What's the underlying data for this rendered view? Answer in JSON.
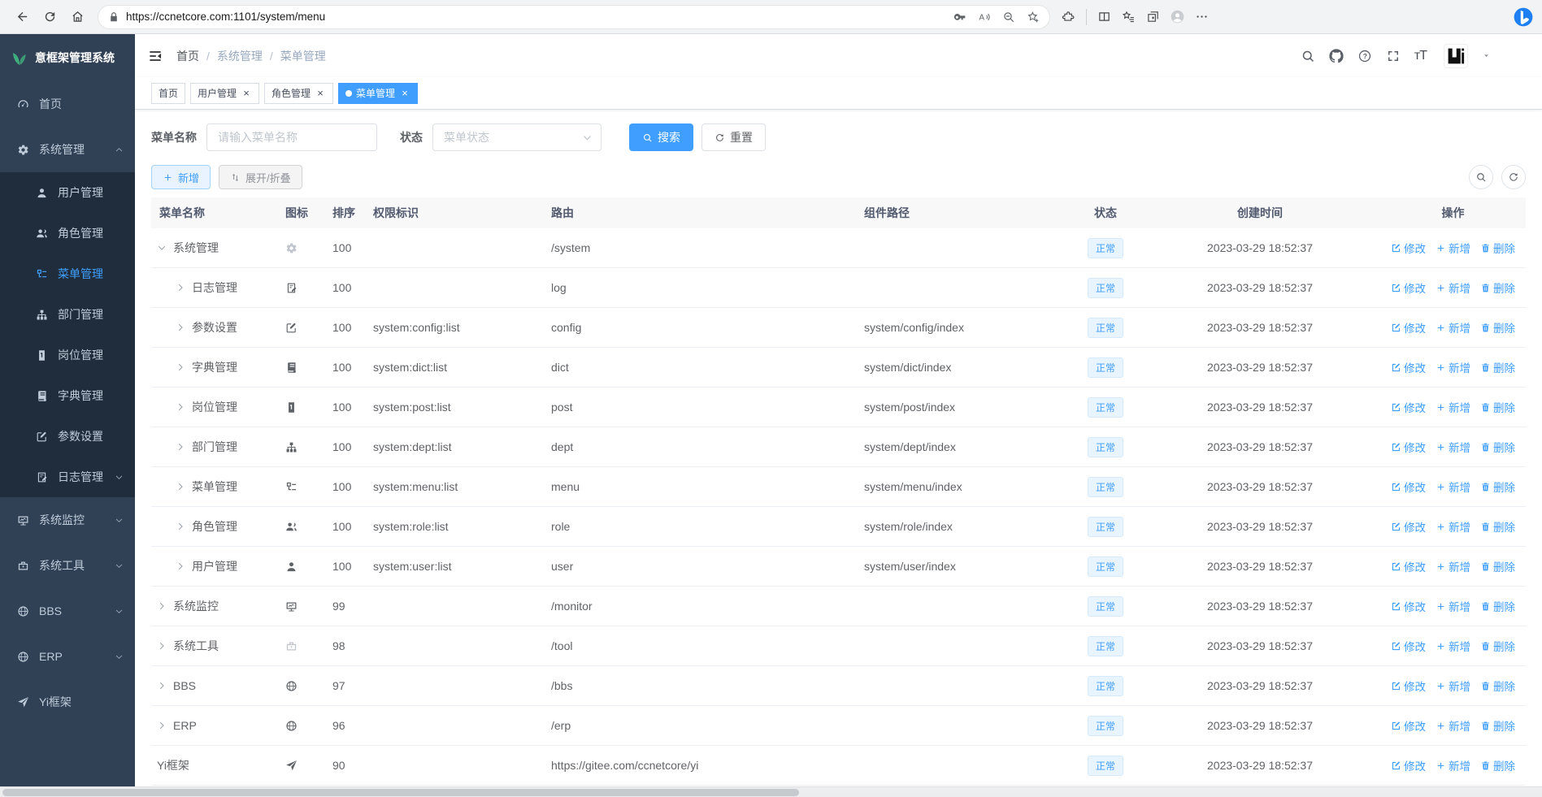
{
  "browser": {
    "url": "https://ccnetcore.com:1101/system/menu"
  },
  "app": {
    "logo_title": "意框架管理系统",
    "breadcrumb": [
      "首页",
      "系统管理",
      "菜单管理"
    ]
  },
  "sidebar": [
    {
      "label": "首页",
      "icon": "dashboard",
      "type": "top"
    },
    {
      "label": "系统管理",
      "icon": "gear",
      "type": "top",
      "caret": "up"
    },
    {
      "label": "用户管理",
      "icon": "user",
      "type": "sub"
    },
    {
      "label": "角色管理",
      "icon": "peoples",
      "type": "sub"
    },
    {
      "label": "菜单管理",
      "icon": "tree-table",
      "type": "sub",
      "active": true
    },
    {
      "label": "部门管理",
      "icon": "tree",
      "type": "sub"
    },
    {
      "label": "岗位管理",
      "icon": "post",
      "type": "sub"
    },
    {
      "label": "字典管理",
      "icon": "dict",
      "type": "sub"
    },
    {
      "label": "参数设置",
      "icon": "edit",
      "type": "sub"
    },
    {
      "label": "日志管理",
      "icon": "log",
      "type": "sub",
      "caret": "down"
    },
    {
      "label": "系统监控",
      "icon": "monitor",
      "type": "top",
      "caret": "down"
    },
    {
      "label": "系统工具",
      "icon": "tool",
      "type": "top",
      "caret": "down"
    },
    {
      "label": "BBS",
      "icon": "globe",
      "type": "top",
      "caret": "down"
    },
    {
      "label": "ERP",
      "icon": "globe",
      "type": "top",
      "caret": "down"
    },
    {
      "label": "Yi框架",
      "icon": "guide",
      "type": "top"
    }
  ],
  "tags": [
    {
      "label": "首页"
    },
    {
      "label": "用户管理",
      "closable": true
    },
    {
      "label": "角色管理",
      "closable": true
    },
    {
      "label": "菜单管理",
      "closable": true,
      "active": true
    }
  ],
  "filter": {
    "name_label": "菜单名称",
    "name_placeholder": "请输入菜单名称",
    "status_label": "状态",
    "status_placeholder": "菜单状态",
    "search": "搜索",
    "reset": "重置"
  },
  "toolbar": {
    "add": "新增",
    "toggle": "展开/折叠"
  },
  "table": {
    "columns": [
      "菜单名称",
      "图标",
      "排序",
      "权限标识",
      "路由",
      "组件路径",
      "状态",
      "创建时间",
      "操作"
    ],
    "ops": {
      "edit": "修改",
      "add": "新增",
      "del": "删除"
    },
    "rows": [
      {
        "name": "系统管理",
        "icon": "gear",
        "order": "100",
        "perm": "",
        "route": "/system",
        "component": "",
        "status": "正常",
        "time": "2023-03-29 18:52:37",
        "level": 0,
        "expand": "down"
      },
      {
        "name": "日志管理",
        "icon": "log",
        "order": "100",
        "perm": "",
        "route": "log",
        "component": "",
        "status": "正常",
        "time": "2023-03-29 18:52:37",
        "level": 1,
        "expand": "right"
      },
      {
        "name": "参数设置",
        "icon": "edit",
        "order": "100",
        "perm": "system:config:list",
        "route": "config",
        "component": "system/config/index",
        "status": "正常",
        "time": "2023-03-29 18:52:37",
        "level": 1,
        "expand": "right"
      },
      {
        "name": "字典管理",
        "icon": "dict",
        "order": "100",
        "perm": "system:dict:list",
        "route": "dict",
        "component": "system/dict/index",
        "status": "正常",
        "time": "2023-03-29 18:52:37",
        "level": 1,
        "expand": "right"
      },
      {
        "name": "岗位管理",
        "icon": "post",
        "order": "100",
        "perm": "system:post:list",
        "route": "post",
        "component": "system/post/index",
        "status": "正常",
        "time": "2023-03-29 18:52:37",
        "level": 1,
        "expand": "right"
      },
      {
        "name": "部门管理",
        "icon": "tree",
        "order": "100",
        "perm": "system:dept:list",
        "route": "dept",
        "component": "system/dept/index",
        "status": "正常",
        "time": "2023-03-29 18:52:37",
        "level": 1,
        "expand": "right"
      },
      {
        "name": "菜单管理",
        "icon": "tree-table",
        "order": "100",
        "perm": "system:menu:list",
        "route": "menu",
        "component": "system/menu/index",
        "status": "正常",
        "time": "2023-03-29 18:52:37",
        "level": 1,
        "expand": "right"
      },
      {
        "name": "角色管理",
        "icon": "peoples",
        "order": "100",
        "perm": "system:role:list",
        "route": "role",
        "component": "system/role/index",
        "status": "正常",
        "time": "2023-03-29 18:52:37",
        "level": 1,
        "expand": "right"
      },
      {
        "name": "用户管理",
        "icon": "user",
        "order": "100",
        "perm": "system:user:list",
        "route": "user",
        "component": "system/user/index",
        "status": "正常",
        "time": "2023-03-29 18:52:37",
        "level": 1,
        "expand": "right"
      },
      {
        "name": "系统监控",
        "icon": "monitor",
        "order": "99",
        "perm": "",
        "route": "/monitor",
        "component": "",
        "status": "正常",
        "time": "2023-03-29 18:52:37",
        "level": 0,
        "expand": "right"
      },
      {
        "name": "系统工具",
        "icon": "tool",
        "order": "98",
        "perm": "",
        "route": "/tool",
        "component": "",
        "status": "正常",
        "time": "2023-03-29 18:52:37",
        "level": 0,
        "expand": "right"
      },
      {
        "name": "BBS",
        "icon": "globe",
        "order": "97",
        "perm": "",
        "route": "/bbs",
        "component": "",
        "status": "正常",
        "time": "2023-03-29 18:52:37",
        "level": 0,
        "expand": "right"
      },
      {
        "name": "ERP",
        "icon": "globe",
        "order": "96",
        "perm": "",
        "route": "/erp",
        "component": "",
        "status": "正常",
        "time": "2023-03-29 18:52:37",
        "level": 0,
        "expand": "right"
      },
      {
        "name": "Yi框架",
        "icon": "guide",
        "order": "90",
        "perm": "",
        "route": "https://gitee.com/ccnetcore/yi",
        "component": "",
        "status": "正常",
        "time": "2023-03-29 18:52:37",
        "level": 0,
        "expand": "none"
      }
    ]
  }
}
